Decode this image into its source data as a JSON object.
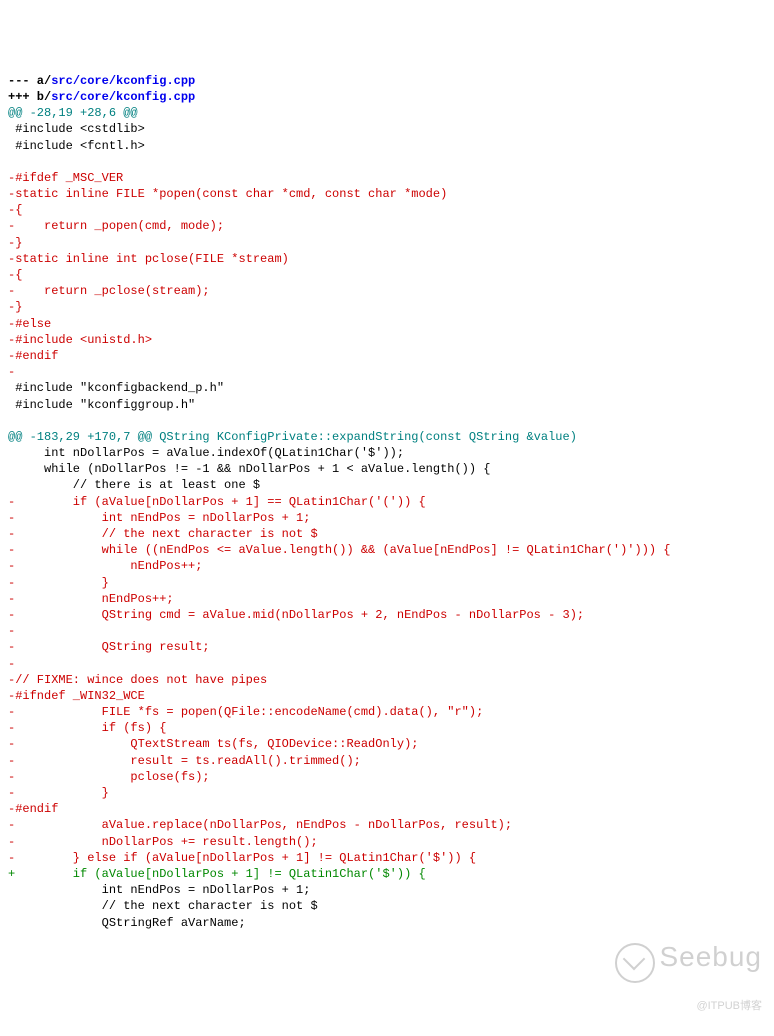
{
  "header": {
    "minus_prefix": "--- a/",
    "minus_path": "src/core/kconfig.cpp",
    "plus_prefix": "+++ b/",
    "plus_path": "src/core/kconfig.cpp"
  },
  "hunk1": "@@ -28,19 +28,6 @@",
  "c01": " #include <cstdlib>",
  "c02": " #include <fcntl.h>",
  "c03": " ",
  "d01": "-#ifdef _MSC_VER",
  "d02": "-static inline FILE *popen(const char *cmd, const char *mode)",
  "d03": "-{",
  "d04": "-    return _popen(cmd, mode);",
  "d05": "-}",
  "d06": "-static inline int pclose(FILE *stream)",
  "d07": "-{",
  "d08": "-    return _pclose(stream);",
  "d09": "-}",
  "d10": "-#else",
  "d11": "-#include <unistd.h>",
  "d12": "-#endif",
  "d13": "-",
  "c04": " #include \"kconfigbackend_p.h\"",
  "c05": " #include \"kconfiggroup.h\"",
  "c06": " ",
  "hunk2": "@@ -183,29 +170,7 @@ QString KConfigPrivate::expandString(const QString &value)",
  "c07": "     int nDollarPos = aValue.indexOf(QLatin1Char('$'));",
  "c08": "     while (nDollarPos != -1 && nDollarPos + 1 < aValue.length()) {",
  "c09": "         // there is at least one $",
  "d14": "-        if (aValue[nDollarPos + 1] == QLatin1Char('(')) {",
  "d15": "-            int nEndPos = nDollarPos + 1;",
  "d16": "-            // the next character is not $",
  "d17": "-            while ((nEndPos <= aValue.length()) && (aValue[nEndPos] != QLatin1Char(')'))) {",
  "d18": "-                nEndPos++;",
  "d19": "-            }",
  "d20": "-            nEndPos++;",
  "d21": "-            QString cmd = aValue.mid(nDollarPos + 2, nEndPos - nDollarPos - 3);",
  "d22": "-",
  "d23": "-            QString result;",
  "d24": "-",
  "d25": "-// FIXME: wince does not have pipes",
  "d26": "-#ifndef _WIN32_WCE",
  "d27": "-            FILE *fs = popen(QFile::encodeName(cmd).data(), \"r\");",
  "d28": "-            if (fs) {",
  "d29": "-                QTextStream ts(fs, QIODevice::ReadOnly);",
  "d30": "-                result = ts.readAll().trimmed();",
  "d31": "-                pclose(fs);",
  "d32": "-            }",
  "d33": "-#endif",
  "d34": "-            aValue.replace(nDollarPos, nEndPos - nDollarPos, result);",
  "d35": "-            nDollarPos += result.length();",
  "d36": "-        } else if (aValue[nDollarPos + 1] != QLatin1Char('$')) {",
  "a01": "+        if (aValue[nDollarPos + 1] != QLatin1Char('$')) {",
  "c10": "             int nEndPos = nDollarPos + 1;",
  "c11": "             // the next character is not $",
  "c12": "             QStringRef aVarName;",
  "watermark": {
    "main": "Seebug",
    "sub": "@ITPUB博客"
  }
}
